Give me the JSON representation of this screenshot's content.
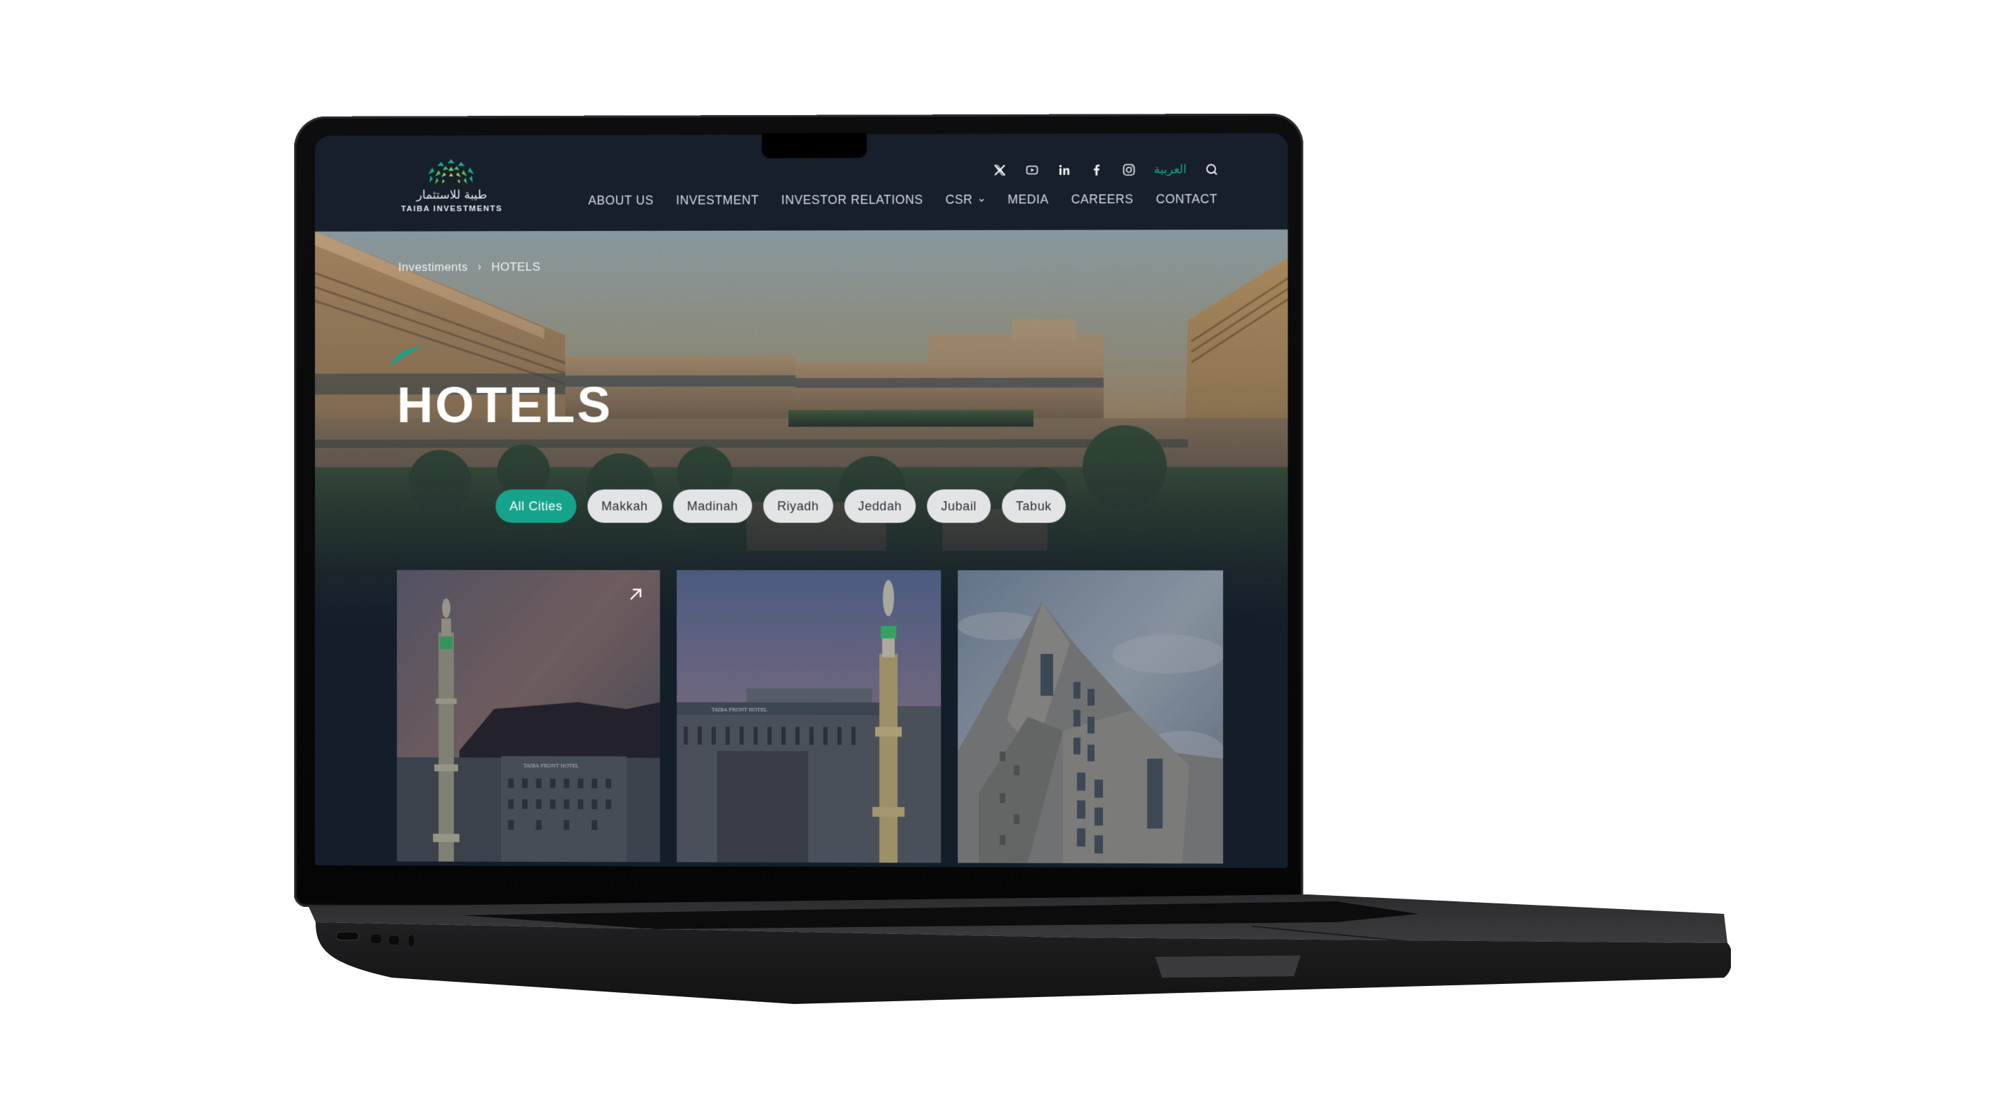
{
  "site": {
    "logo": {
      "arabic_name": "طيبة للاستثمار",
      "english_name": "TAIBA INVESTMENTS"
    },
    "utility": {
      "social_icons": [
        "x-twitter-icon",
        "youtube-icon",
        "linkedin-icon",
        "facebook-icon",
        "instagram-icon"
      ],
      "language_toggle": "العربية",
      "search_icon": "search-icon"
    },
    "nav": [
      {
        "label": "ABOUT US"
      },
      {
        "label": "INVESTMENT"
      },
      {
        "label": "INVESTOR RELATIONS"
      },
      {
        "label": "CSR",
        "has_dropdown": true
      },
      {
        "label": "MEDIA"
      },
      {
        "label": "CAREERS"
      },
      {
        "label": "CONTACT"
      }
    ]
  },
  "breadcrumb": {
    "items": [
      "Investiments",
      "HOTELS"
    ],
    "separator": "›"
  },
  "page": {
    "title": "HOTELS"
  },
  "filters": {
    "options": [
      "All Cities",
      "Makkah",
      "Madinah",
      "Riyadh",
      "Jeddah",
      "Jubail",
      "Tabuk"
    ],
    "selected": "All Cities"
  },
  "cards": [
    {
      "image": "Madinah minaret with Taiba Front Hotel at dusk and mountains",
      "sign_text": "TAIBA FRONT HOTEL",
      "has_link_arrow": true
    },
    {
      "image": "Taiba Front Hotel facade beside illuminated minaret at twilight",
      "sign_text": "TAIBA FRONT HOTEL",
      "has_link_arrow": false
    },
    {
      "image": "Ornate stone hotel tower viewed from below against cloudy sky",
      "sign_text": "",
      "has_link_arrow": false
    }
  ],
  "colors": {
    "header_bg": "#161f2a",
    "accent": "#15a48b",
    "pill_bg": "#e3e4e6",
    "text_light": "#d7dce1"
  }
}
